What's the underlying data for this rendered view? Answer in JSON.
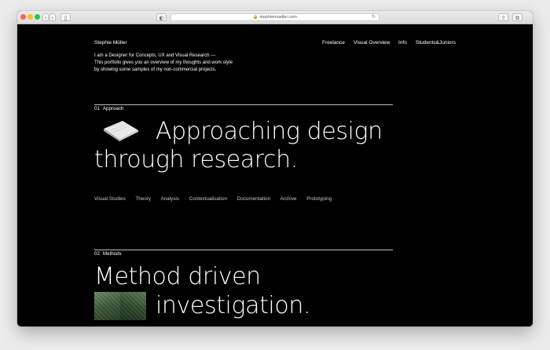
{
  "browser": {
    "url": "stephiemueller.com",
    "lock_icon": "lock-icon",
    "reload_icon": "reload-icon"
  },
  "site": {
    "brand": "Stephie Müller",
    "nav": [
      "Freelance",
      "Visual Overview",
      "Info",
      "Students&Juniors"
    ],
    "intro_lines": [
      "I am a Designer for Concepts, UX and Visual Research —",
      "This portfolio gives you an overview of my thoughts and work style",
      "by showing some samples of my non-commercial projects."
    ]
  },
  "sections": [
    {
      "num": "01",
      "label": "Approach",
      "headline_line1": "Approaching design",
      "headline_line2": "through research.",
      "tags": [
        "Visual Studies",
        "Theory",
        "Analysis",
        "Contextualisation",
        "Documentation",
        "Archive",
        "Prototyping"
      ]
    },
    {
      "num": "02",
      "label": "Methods",
      "headline_line1": "Method driven",
      "headline_line2": "investigation."
    }
  ]
}
